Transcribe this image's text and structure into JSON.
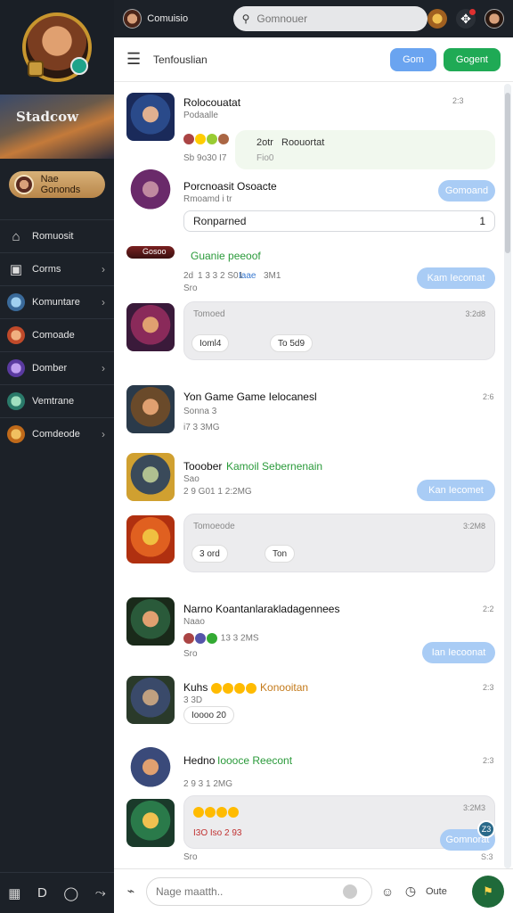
{
  "sidebar": {
    "banner_title": "Stadcow",
    "status_label": "Nae Gononds",
    "items": [
      {
        "label": "Romuosit",
        "icon": "home-icon",
        "chevron": false
      },
      {
        "label": "Corms",
        "icon": "calendar-icon",
        "chevron": true
      },
      {
        "label": "Komuntare",
        "icon": "avatar-icon",
        "chevron": true
      },
      {
        "label": "Comoade",
        "icon": "avatar-icon",
        "chevron": false
      },
      {
        "label": "Domber",
        "icon": "avatar-icon",
        "chevron": true
      },
      {
        "label": "Vemtrane",
        "icon": "avatar-icon",
        "chevron": false
      },
      {
        "label": "Comdeode",
        "icon": "avatar-icon",
        "chevron": true
      }
    ],
    "bottom_icons": [
      "grid-icon",
      "d-icon",
      "chat-icon",
      "share-icon"
    ]
  },
  "topbar": {
    "user_name": "Comuisio",
    "search_placeholder": "Gomnouer"
  },
  "subbar": {
    "title": "Tenfouslian",
    "button_primary": "Gom",
    "button_secondary": "Gogent"
  },
  "feed": {
    "items": [
      {
        "name": "Rolocouatat",
        "sub": "Podaalle",
        "time": "2:3",
        "reactions": "3sb",
        "meta": "Sb   9o30   I7",
        "bubble_main": "2otr",
        "bubble_text": "Roouortat",
        "bubble_sub": "Fio0"
      },
      {
        "name": "Porcnoasit Osoacte",
        "sub": "Rmoamd i tr",
        "input": "Ronparned",
        "input_count": "1",
        "chip": "Gomoand"
      },
      {
        "tag": "Gosoo",
        "name": "Guanie peeoof",
        "meta_a": "2d",
        "meta_b": "1 3 3 2 S01",
        "meta_c": "Iaae",
        "meta_d": "3M1",
        "meta_e": "Sro",
        "chip": "Kam Iecomat"
      },
      {
        "bubble_label": "Tomoed",
        "bubble_time": "3:2d8",
        "pill_a": "Ioml4",
        "pill_b": "To 5d9"
      },
      {
        "name": "Yon Game  Game Ielocanesl",
        "meta": "Sonna 3",
        "meta_b": "i7   3  3MG",
        "time": "2:6"
      },
      {
        "name_a": "Tooober",
        "name_b": "Kamoil Sebernenain",
        "sub": "Sao",
        "meta": "2 9 G01   1   2:2MG",
        "chip": "Kan Iecomet"
      },
      {
        "bubble_label": "Tomoeode",
        "bubble_time": "3:2M8",
        "pill_a": "3 ord",
        "pill_b": "Ton"
      },
      {
        "name": "Narno Koantanlarakladagennees",
        "sub": "Naao",
        "meta": "13   3 2MS",
        "meta2": "Sro",
        "time": "2:2",
        "chip": "Ian Iecoonat"
      },
      {
        "name_a": "Kuhs",
        "name_b": "Konooitan",
        "sub": "3 3D",
        "pill": "Ioooo 20",
        "time": "2:3"
      },
      {
        "name_a": "Hedno",
        "name_b": "Ioooce  Reecont",
        "meta": "2 9 3   1   2MG",
        "time": "2:3"
      },
      {
        "bubble_time": "3:2M3",
        "bubble_text": "I3O Iso 2 93",
        "chip": "Gomnorat",
        "badge": "Z3",
        "meta": "Sro",
        "time": "S:3"
      }
    ]
  },
  "composer": {
    "placeholder": "Nage maatth..",
    "label": "Oute"
  },
  "colors": {
    "sidebar_bg": "#1c2128",
    "accent_blue": "#6aa4f0",
    "accent_green": "#1faa55",
    "chip_blue": "#a9ccf5"
  }
}
